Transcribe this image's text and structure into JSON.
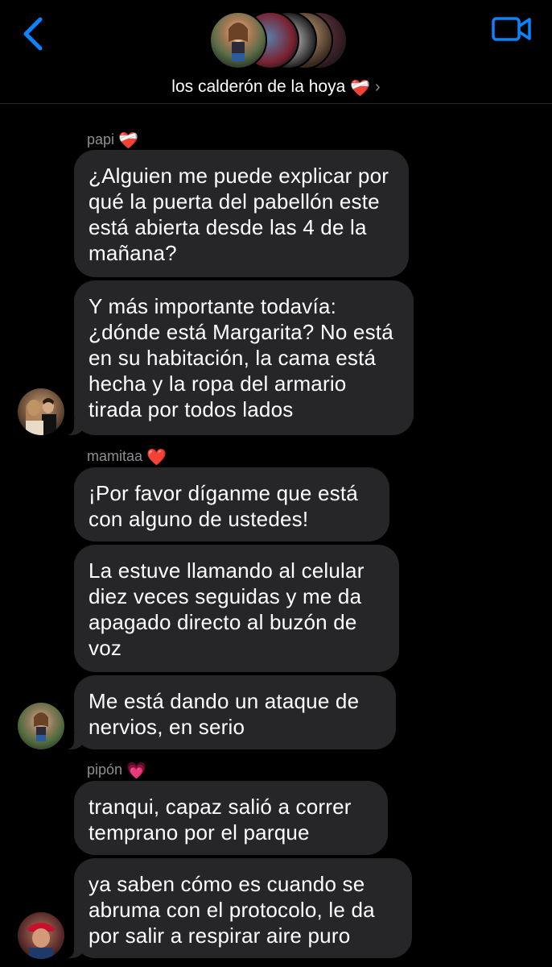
{
  "header": {
    "group_name": "los calderón de la hoya",
    "group_emoji": "❤️‍🩹",
    "chevron": "›",
    "back_icon": "chevron-left-icon",
    "video_icon": "video-camera-icon",
    "accent_color": "#0a84ff"
  },
  "messages": [
    {
      "sender": "papi",
      "sender_emoji": "❤️‍🩹",
      "bubbles": [
        "¿Alguien me puede explicar por qué la puerta del pabellón este está abierta desde las 4 de la mañana?",
        "Y más importante todavía: ¿dónde está Margarita? No está en su habitación, la cama está hecha y la ropa del armario tirada por todos lados"
      ]
    },
    {
      "sender": "mamitaa",
      "sender_emoji": "❤️",
      "bubbles": [
        "¡Por favor díganme que está con alguno de ustedes!",
        "La estuve llamando al celular diez veces seguidas y me da apagado directo al buzón de voz",
        "Me está dando un ataque de nervios, en serio"
      ]
    },
    {
      "sender": "pipón",
      "sender_emoji": "💗",
      "bubbles": [
        "tranqui, capaz salió a correr temprano por el parque",
        "ya saben cómo es cuando se abruma con el protocolo, le da por salir a respirar aire puro"
      ]
    }
  ],
  "colors": {
    "background": "#000000",
    "bubble": "#262629",
    "sender_label": "#8e8e93"
  }
}
